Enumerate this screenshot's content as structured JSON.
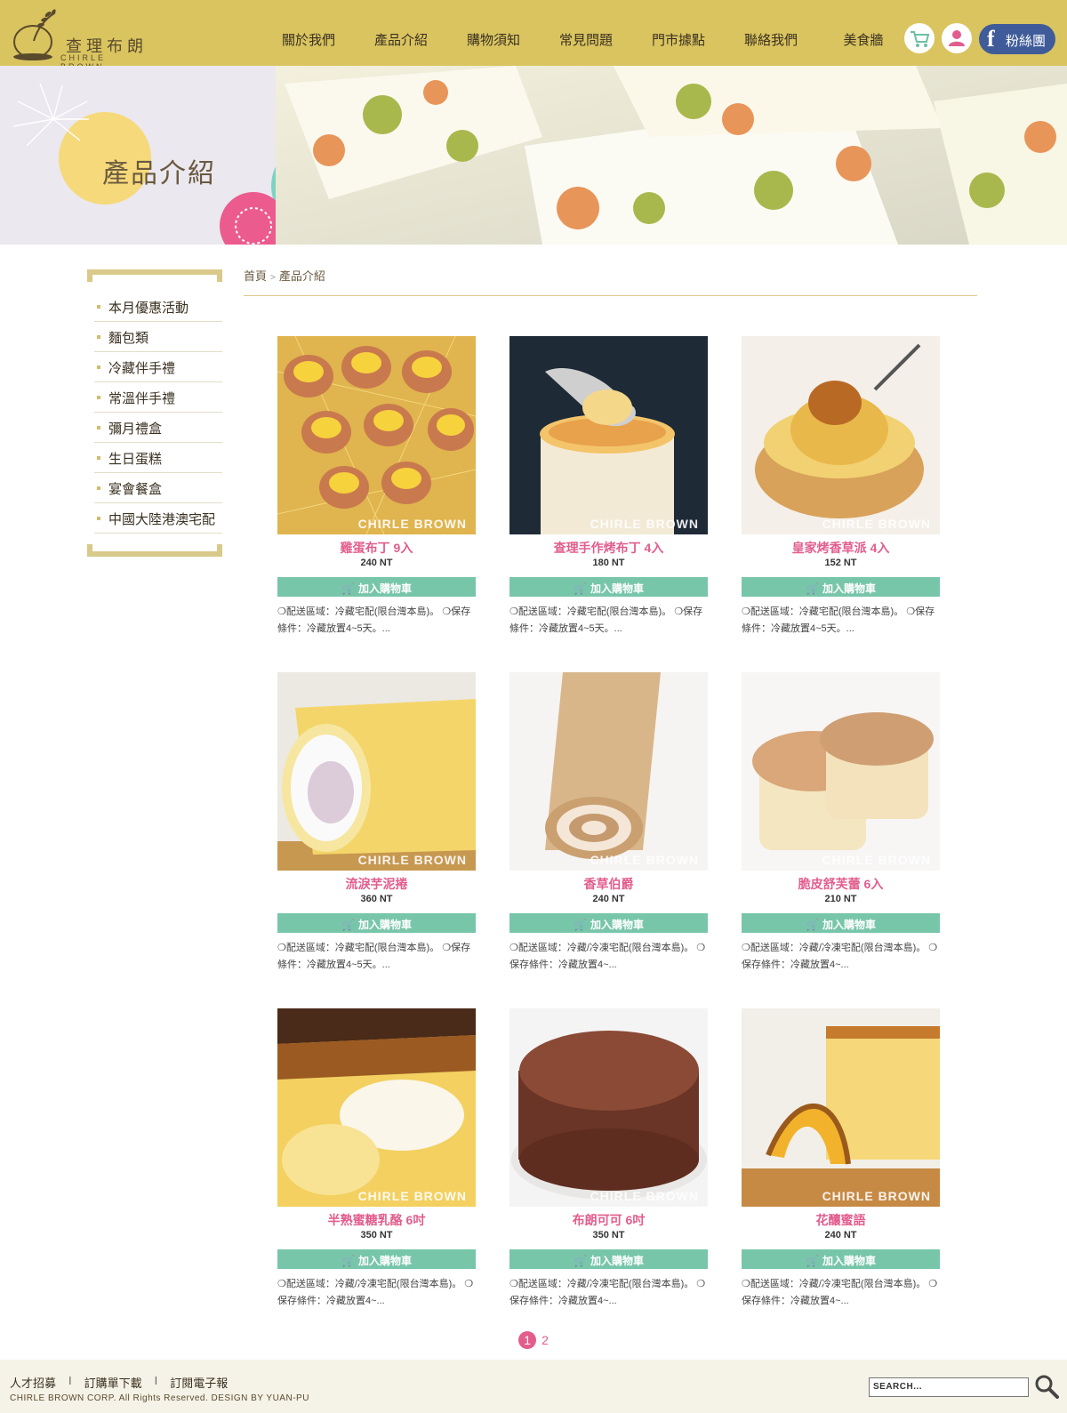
{
  "brand": {
    "name_cn": "查理布朗",
    "name_en": "CHIRLE BROWN"
  },
  "nav": [
    "關於我們",
    "產品介紹",
    "購物須知",
    "常見問題",
    "門市據點",
    "聯絡我們",
    "美食牆"
  ],
  "header_icons": {
    "cart": "cart-icon",
    "member": "user-icon",
    "facebook_label": "粉絲團"
  },
  "banner": {
    "title": "產品介紹"
  },
  "sidebar": [
    "本月優惠活動",
    "麵包類",
    "冷藏伴手禮",
    "常溫伴手禮",
    "彌月禮盒",
    "生日蛋糕",
    "宴會餐盒",
    "中國大陸港澳宅配"
  ],
  "breadcrumb": {
    "home": "首頁",
    "sep": ">",
    "current": "產品介紹"
  },
  "cart_label": "加入購物車",
  "watermark": "CHIRLE BROWN",
  "products": [
    {
      "name": "雞蛋布丁 9入",
      "price": "240 NT",
      "desc": "❍配送區域：冷藏宅配(限台灣本島)。 ❍保存條件：冷藏放置4~5天。..."
    },
    {
      "name": "查理手作烤布丁 4入",
      "price": "180 NT",
      "desc": "❍配送區域：冷藏宅配(限台灣本島)。 ❍保存條件：冷藏放置4~5天。..."
    },
    {
      "name": "皇家烤香草派 4入",
      "price": "152 NT",
      "desc": "❍配送區域：冷藏宅配(限台灣本島)。 ❍保存條件：冷藏放置4~5天。..."
    },
    {
      "name": "流淚芋泥捲",
      "price": "360 NT",
      "desc": "❍配送區域：冷藏宅配(限台灣本島)。 ❍保存條件：冷藏放置4~5天。..."
    },
    {
      "name": "香草伯爵",
      "price": "240 NT",
      "desc": "❍配送區域：冷藏/冷凍宅配(限台灣本島)。 ❍保存條件：冷藏放置4~..."
    },
    {
      "name": "脆皮舒芙蕾 6入",
      "price": "210 NT",
      "desc": "❍配送區域：冷藏/冷凍宅配(限台灣本島)。 ❍保存條件：冷藏放置4~..."
    },
    {
      "name": "半熟蜜糖乳酪 6吋",
      "price": "350 NT",
      "desc": "❍配送區域：冷藏/冷凍宅配(限台灣本島)。 ❍保存條件：冷藏放置4~..."
    },
    {
      "name": "布朗可可 6吋",
      "price": "350 NT",
      "desc": "❍配送區域：冷藏/冷凍宅配(限台灣本島)。 ❍保存條件：冷藏放置4~..."
    },
    {
      "name": "花釀蜜語",
      "price": "240 NT",
      "desc": "❍配送區域：冷藏/冷凍宅配(限台灣本島)。 ❍保存條件：冷藏放置4~..."
    }
  ],
  "pagination": {
    "current": "1",
    "next": "2"
  },
  "footer": {
    "links": [
      "人才招募",
      "訂購單下載",
      "訂閱電子報"
    ],
    "copyright": "CHIRLE BROWN  CORP. All Rights Reserved.   DESIGN BY YUAN-PU",
    "search_placeholder": "SEARCH..."
  },
  "colors": {
    "header": "#d9c460",
    "accent_pink": "#e25d8c",
    "cart_green": "#78c6aa"
  }
}
